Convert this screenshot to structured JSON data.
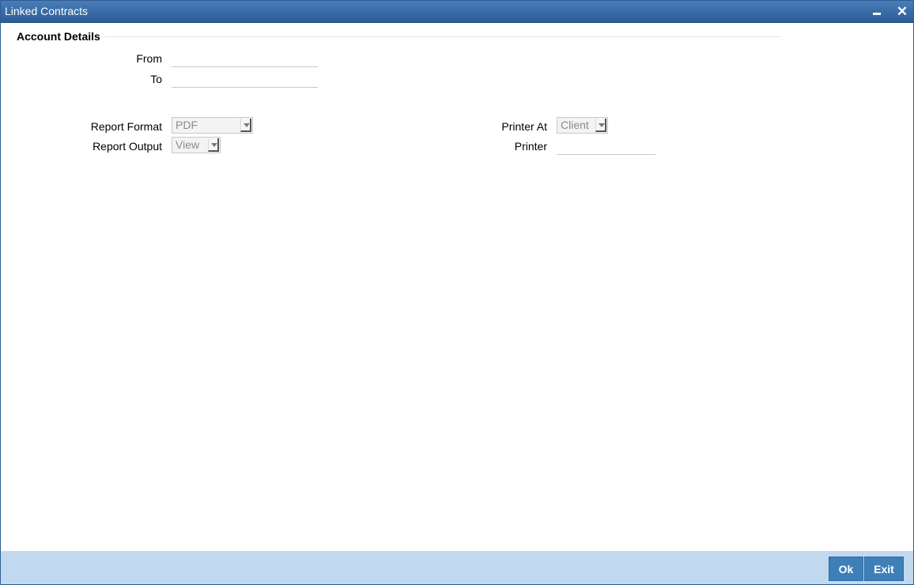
{
  "window": {
    "title": "Linked Contracts"
  },
  "titlebar": {
    "minimize_glyph": "",
    "close_glyph": "✕"
  },
  "section": {
    "title": "Account Details"
  },
  "fields": {
    "from_label": "From",
    "from_value": "",
    "to_label": "To",
    "to_value": "",
    "report_format_label": "Report Format",
    "report_format_value": "PDF",
    "report_output_label": "Report Output",
    "report_output_value": "View",
    "printer_at_label": "Printer At",
    "printer_at_value": "Client",
    "printer_label": "Printer",
    "printer_value": ""
  },
  "footer": {
    "ok_label": "Ok",
    "exit_label": "Exit"
  },
  "colors": {
    "titlebar": "#2a5d98",
    "footer": "#c1d9ef",
    "button": "#3f7fb8"
  }
}
